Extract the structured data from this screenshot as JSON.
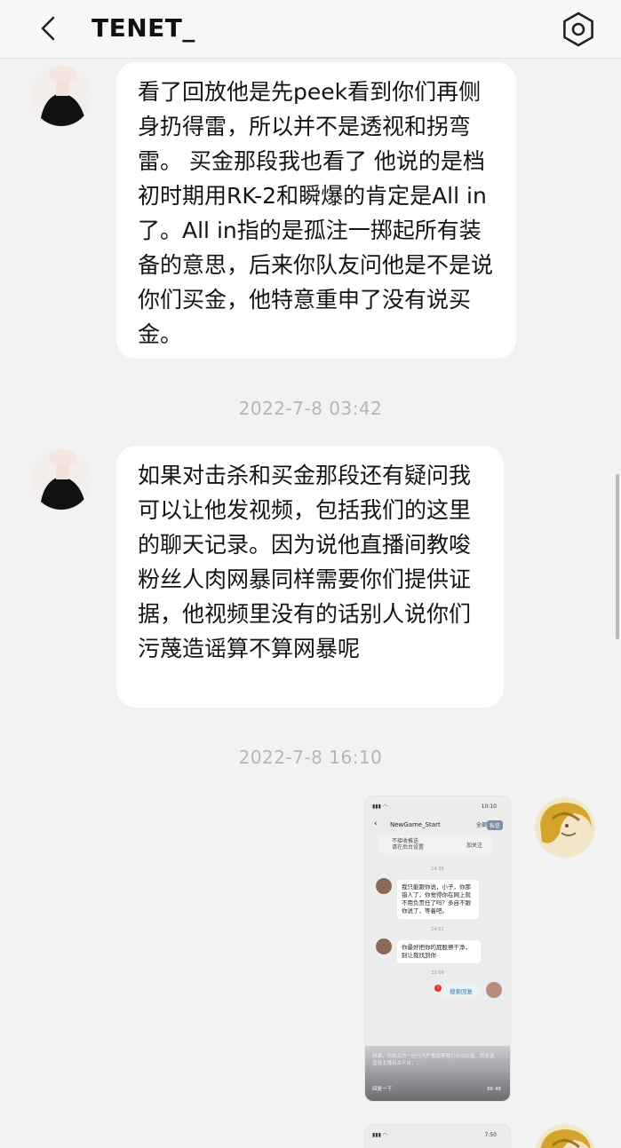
{
  "header": {
    "title": "TENET_"
  },
  "messages": [
    {
      "text": "看了回放他是先peek看到你们再侧身扔得雷，所以并不是透视和拐弯雷。 买金那段我也看了 他说的是档初时期用RK-2和瞬爆的肯定是All in了。All in指的是孤注一掷起所有装备的意思，后来你队友问他是不是说你们买金，他特意重申了没有说买金。"
    },
    {
      "text": "如果对击杀和买金那段还有疑问我可以让他发视频，包括我们的这里的聊天记录。因为说他直播间教唆粉丝人肉网暴同样需要你们提供证据，他视频里没有的话别人说你们污蔑造谣算不算网暴呢"
    }
  ],
  "timestamps": [
    "2022-7-8 03:42",
    "2022-7-8 16:10"
  ],
  "screenshot_message": {
    "status_time": "10:10",
    "app_title": "NewGame_Start",
    "header_btn1": "全部",
    "header_btn2": "私信",
    "notice_line1": "不接收推送",
    "notice_line2": "请在后台设置",
    "follow_label": "加关注",
    "time1": "14:35",
    "msg1": "我只能跟你说，小子，你那错人了，你觉得你在网上就不用负责任了吗？多自不跟你说了，等着吧。",
    "time2": "14:51",
    "msg2": "你最好把你的屁股擦干净，别让我找到你",
    "time3": "22:09",
    "chip": "搜索回复",
    "bottom_text": "网暴，他相关的一些行为严重损害我们合法权益，同意请直接主播有关平台，...",
    "bottom_left": "回复一下",
    "bottom_stats": "66  48"
  },
  "second_screenshot": {
    "status_time": "7:50"
  },
  "icons": {
    "back": "chevron-left-icon",
    "settings": "hexagon-settings-icon"
  },
  "colors": {
    "background": "#f2f2f2",
    "bubble": "#ffffff",
    "timestamp": "#b6b6b6"
  }
}
